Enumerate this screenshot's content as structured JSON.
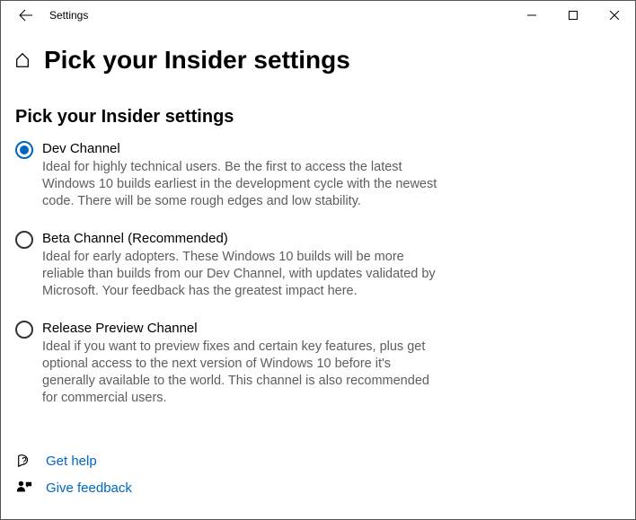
{
  "window": {
    "app_title": "Settings"
  },
  "header": {
    "page_title": "Pick your Insider settings"
  },
  "section": {
    "heading": "Pick your Insider settings"
  },
  "options": [
    {
      "title": "Dev Channel",
      "desc": "Ideal for highly technical users. Be the first to access the latest Windows 10 builds earliest in the development cycle with the newest code. There will be some rough edges and low stability.",
      "selected": true
    },
    {
      "title": "Beta Channel (Recommended)",
      "desc": "Ideal for early adopters. These Windows 10 builds will be more reliable than builds from our Dev Channel, with updates validated by Microsoft. Your feedback has the greatest impact here.",
      "selected": false
    },
    {
      "title": "Release Preview Channel",
      "desc": "Ideal if you want to preview fixes and certain key features, plus get optional access to the next version of Windows 10 before it's generally available to the world. This channel is also recommended for commercial users.",
      "selected": false
    }
  ],
  "footer": {
    "help": "Get help",
    "feedback": "Give feedback"
  }
}
